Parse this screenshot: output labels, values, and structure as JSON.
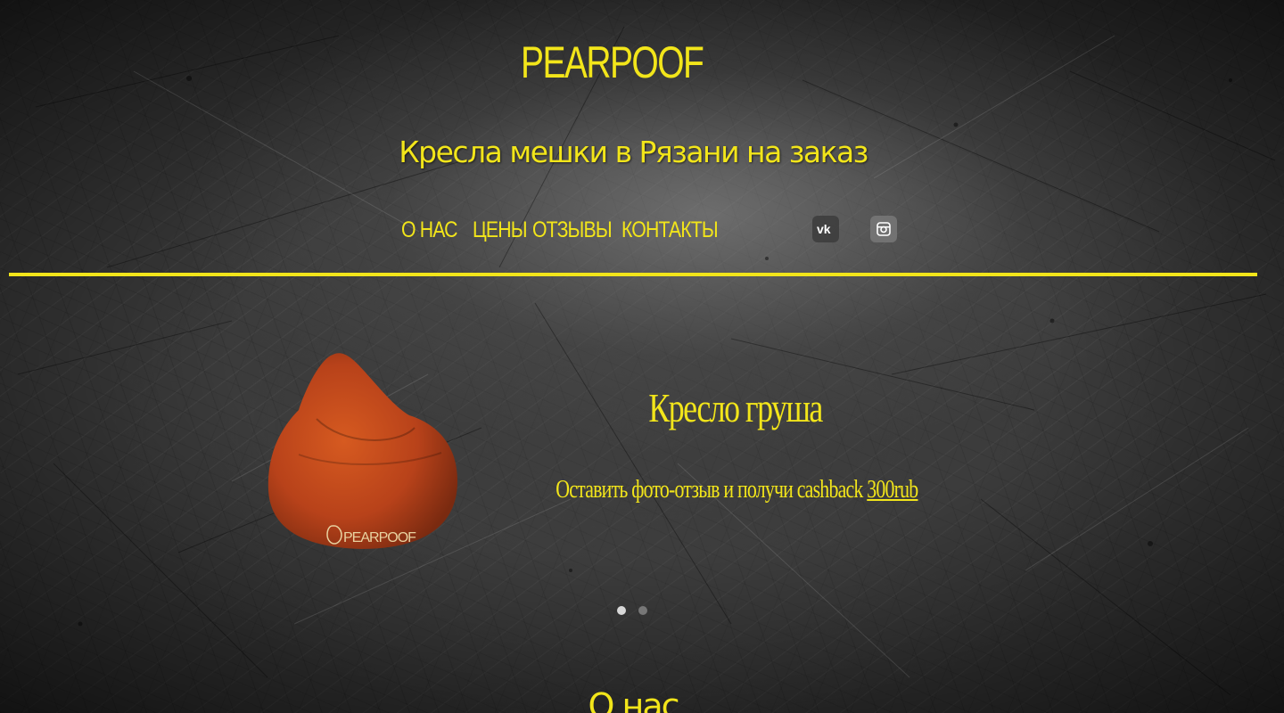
{
  "brand": {
    "name": "PEARPOOF",
    "tagline": "Кресла мешки в Рязани на заказ",
    "accent_color": "#f2e51a"
  },
  "nav": {
    "items": [
      {
        "label": "О НАС"
      },
      {
        "label": "ЦЕНЫ"
      },
      {
        "label": "ОТЗЫВЫ"
      },
      {
        "label": "КОНТАКТЫ"
      }
    ],
    "social": [
      {
        "icon": "vk-icon"
      },
      {
        "icon": "instagram-icon"
      }
    ]
  },
  "slider": {
    "title": "Кресло груша",
    "subtitle_main": "Оставить фото-отзыв и получи cashback ",
    "subtitle_amount": "300rub",
    "product_image": {
      "brand_text": "PEARPOOF",
      "color": "#c0461a"
    },
    "slides_count": 2,
    "active_slide": 1
  },
  "about": {
    "title": "О нас"
  }
}
